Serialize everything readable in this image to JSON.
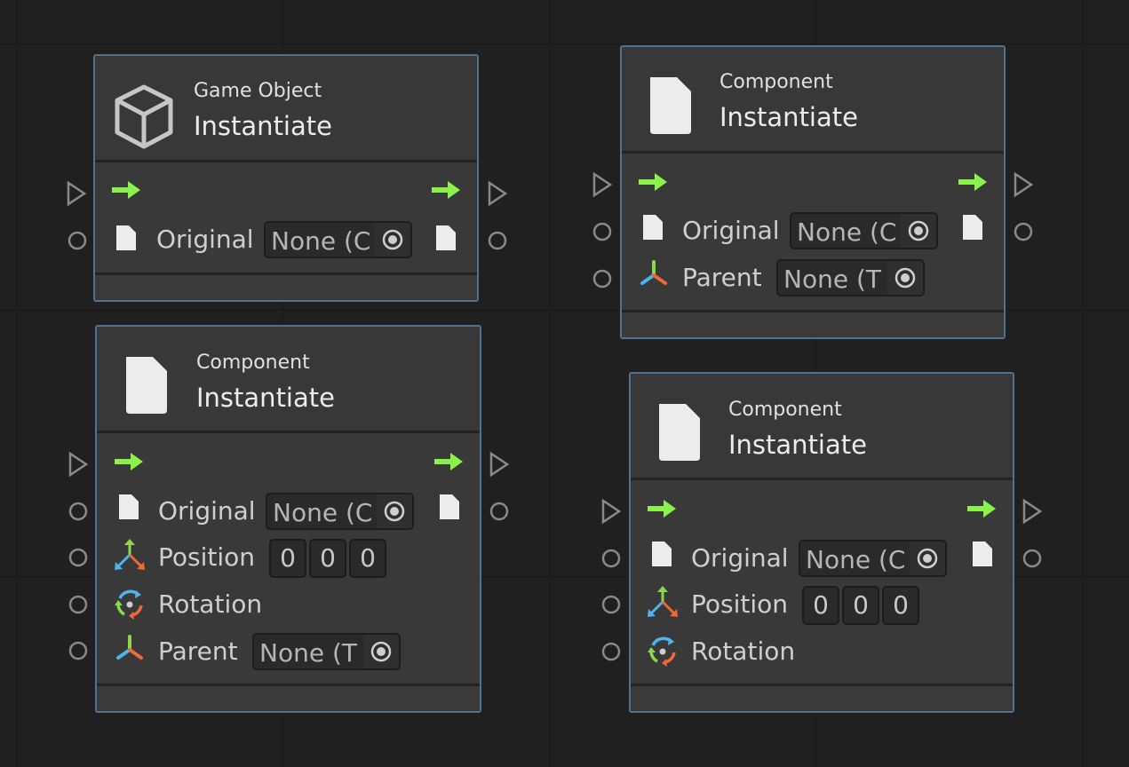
{
  "nodes": [
    {
      "subtitle": "Game Object",
      "title": "Instantiate",
      "header_icon": "cube-icon",
      "inputs": [
        {
          "label": "Original",
          "icon": "document-icon",
          "field": "None (C"
        }
      ]
    },
    {
      "subtitle": "Component",
      "title": "Instantiate",
      "header_icon": "document-icon",
      "inputs": [
        {
          "label": "Original",
          "icon": "document-icon",
          "field": "None (C"
        },
        {
          "label": "Parent",
          "icon": "transform-axes-icon",
          "field": "None (T"
        }
      ]
    },
    {
      "subtitle": "Component",
      "title": "Instantiate",
      "header_icon": "document-icon",
      "inputs": [
        {
          "label": "Original",
          "icon": "document-icon",
          "field": "None (C"
        },
        {
          "label": "Position",
          "icon": "move-axes-icon",
          "values": [
            "0",
            "0",
            "0"
          ]
        },
        {
          "label": "Rotation",
          "icon": "rotate-icon"
        },
        {
          "label": "Parent",
          "icon": "transform-axes-icon",
          "field": "None (T"
        }
      ]
    },
    {
      "subtitle": "Component",
      "title": "Instantiate",
      "header_icon": "document-icon",
      "inputs": [
        {
          "label": "Original",
          "icon": "document-icon",
          "field": "None (C"
        },
        {
          "label": "Position",
          "icon": "move-axes-icon",
          "values": [
            "0",
            "0",
            "0"
          ]
        },
        {
          "label": "Rotation",
          "icon": "rotate-icon"
        }
      ]
    }
  ],
  "colors": {
    "flow_arrow": "#8bf24b",
    "node_border": "#4d7390",
    "node_body": "#393939",
    "canvas": "#202020"
  }
}
